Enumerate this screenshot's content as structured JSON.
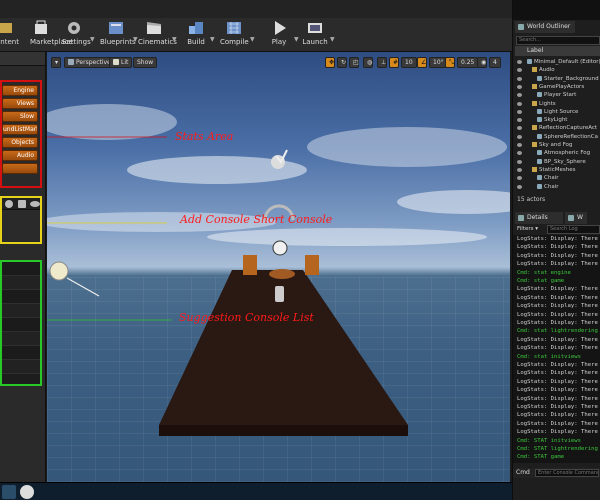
{
  "toolbar": {
    "items": [
      {
        "label": "ontent",
        "icon": "content-icon"
      },
      {
        "label": "Marketplace",
        "icon": "marketplace-icon"
      },
      {
        "label": "Settings",
        "icon": "settings-icon"
      },
      {
        "label": "Blueprints",
        "icon": "blueprints-icon"
      },
      {
        "label": "Cinematics",
        "icon": "cinematics-icon"
      },
      {
        "label": "Build",
        "icon": "build-icon"
      },
      {
        "label": "Compile",
        "icon": "compile-icon"
      },
      {
        "label": "Play",
        "icon": "play-icon"
      },
      {
        "label": "Launch",
        "icon": "launch-icon"
      }
    ]
  },
  "left_panel": {
    "stat_buttons": [
      "Engine",
      "Views",
      "Slow",
      "undListMark",
      "Objects",
      "Audio",
      ""
    ]
  },
  "viewport": {
    "perspective_label": "Perspective",
    "lit_label": "Lit",
    "show_label": "Show",
    "grid_snap": "10",
    "rot_snap": "10°",
    "scale_snap": "0.25",
    "cam_speed": "4",
    "annotations": {
      "stats": "Stats Area",
      "console": "Add Console Short Console",
      "suggestion": "Suggestion Console List"
    },
    "colors": {
      "stats": "#d41010",
      "console": "#e6d21a",
      "suggestion": "#28c828"
    }
  },
  "outliner": {
    "tab": "World Outliner",
    "search_placeholder": "Search...",
    "column": "Label",
    "rows": [
      {
        "label": "Minimal_Default (Editor)",
        "kind": "obj",
        "indent": 0
      },
      {
        "label": "Audio",
        "kind": "folder",
        "indent": 1
      },
      {
        "label": "Starter_Background",
        "kind": "obj",
        "indent": 2
      },
      {
        "label": "GamePlayActors",
        "kind": "folder",
        "indent": 1
      },
      {
        "label": "Player Start",
        "kind": "obj",
        "indent": 2
      },
      {
        "label": "Lights",
        "kind": "folder",
        "indent": 1
      },
      {
        "label": "Light Source",
        "kind": "obj",
        "indent": 2
      },
      {
        "label": "SkyLight",
        "kind": "obj",
        "indent": 2
      },
      {
        "label": "ReflectionCaptureAct",
        "kind": "folder",
        "indent": 1
      },
      {
        "label": "SphereReflectionCa",
        "kind": "obj",
        "indent": 2
      },
      {
        "label": "Sky and Fog",
        "kind": "folder",
        "indent": 1
      },
      {
        "label": "Atmospheric Fog",
        "kind": "obj",
        "indent": 2
      },
      {
        "label": "BP_Sky_Sphere",
        "kind": "obj",
        "indent": 2
      },
      {
        "label": "StaticMeshes",
        "kind": "folder",
        "indent": 1
      },
      {
        "label": "Chair",
        "kind": "obj",
        "indent": 2
      },
      {
        "label": "Chair",
        "kind": "obj",
        "indent": 2
      }
    ],
    "actor_count": "15 actors"
  },
  "details": {
    "tab": "Details",
    "tab2": "W"
  },
  "output_log": {
    "filters_label": "Filters",
    "search_placeholder": "Search Log",
    "lines": [
      {
        "text": "LogStats: Display: There",
        "color": "#d0d0d0"
      },
      {
        "text": "LogStats: Display: There",
        "color": "#d0d0d0"
      },
      {
        "text": "LogStats: Display: There",
        "color": "#d0d0d0"
      },
      {
        "text": "LogStats: Display: There",
        "color": "#d0d0d0"
      },
      {
        "text": "Cmd: stat engine",
        "color": "#3cc83c"
      },
      {
        "text": "Cmd: stat game",
        "color": "#3cc83c"
      },
      {
        "text": "LogStats: Display: There",
        "color": "#d0d0d0"
      },
      {
        "text": "LogStats: Display: There",
        "color": "#d0d0d0"
      },
      {
        "text": "LogStats: Display: There",
        "color": "#d0d0d0"
      },
      {
        "text": "LogStats: Display: There",
        "color": "#d0d0d0"
      },
      {
        "text": "LogStats: Display: There",
        "color": "#d0d0d0"
      },
      {
        "text": "Cmd: stat lightrendering",
        "color": "#3cc83c"
      },
      {
        "text": "LogStats: Display: There",
        "color": "#d0d0d0"
      },
      {
        "text": "LogStats: Display: There",
        "color": "#d0d0d0"
      },
      {
        "text": "Cmd: stat initviews",
        "color": "#3cc83c"
      },
      {
        "text": "LogStats: Display: There",
        "color": "#d0d0d0"
      },
      {
        "text": "LogStats: Display: There",
        "color": "#d0d0d0"
      },
      {
        "text": "LogStats: Display: There",
        "color": "#d0d0d0"
      },
      {
        "text": "LogStats: Display: There",
        "color": "#d0d0d0"
      },
      {
        "text": "LogStats: Display: There",
        "color": "#d0d0d0"
      },
      {
        "text": "LogStats: Display: There",
        "color": "#d0d0d0"
      },
      {
        "text": "LogStats: Display: There",
        "color": "#d0d0d0"
      },
      {
        "text": "LogStats: Display: There",
        "color": "#d0d0d0"
      },
      {
        "text": "LogStats: Display: There",
        "color": "#d0d0d0"
      },
      {
        "text": "Cmd: STAT initviews",
        "color": "#3cc83c"
      },
      {
        "text": "Cmd: STAT lightrendering",
        "color": "#3cc83c"
      },
      {
        "text": "Cmd: STAT game",
        "color": "#3cc83c"
      }
    ],
    "cmd_label": "Cmd",
    "cmd_placeholder": "Enter Console Command"
  }
}
